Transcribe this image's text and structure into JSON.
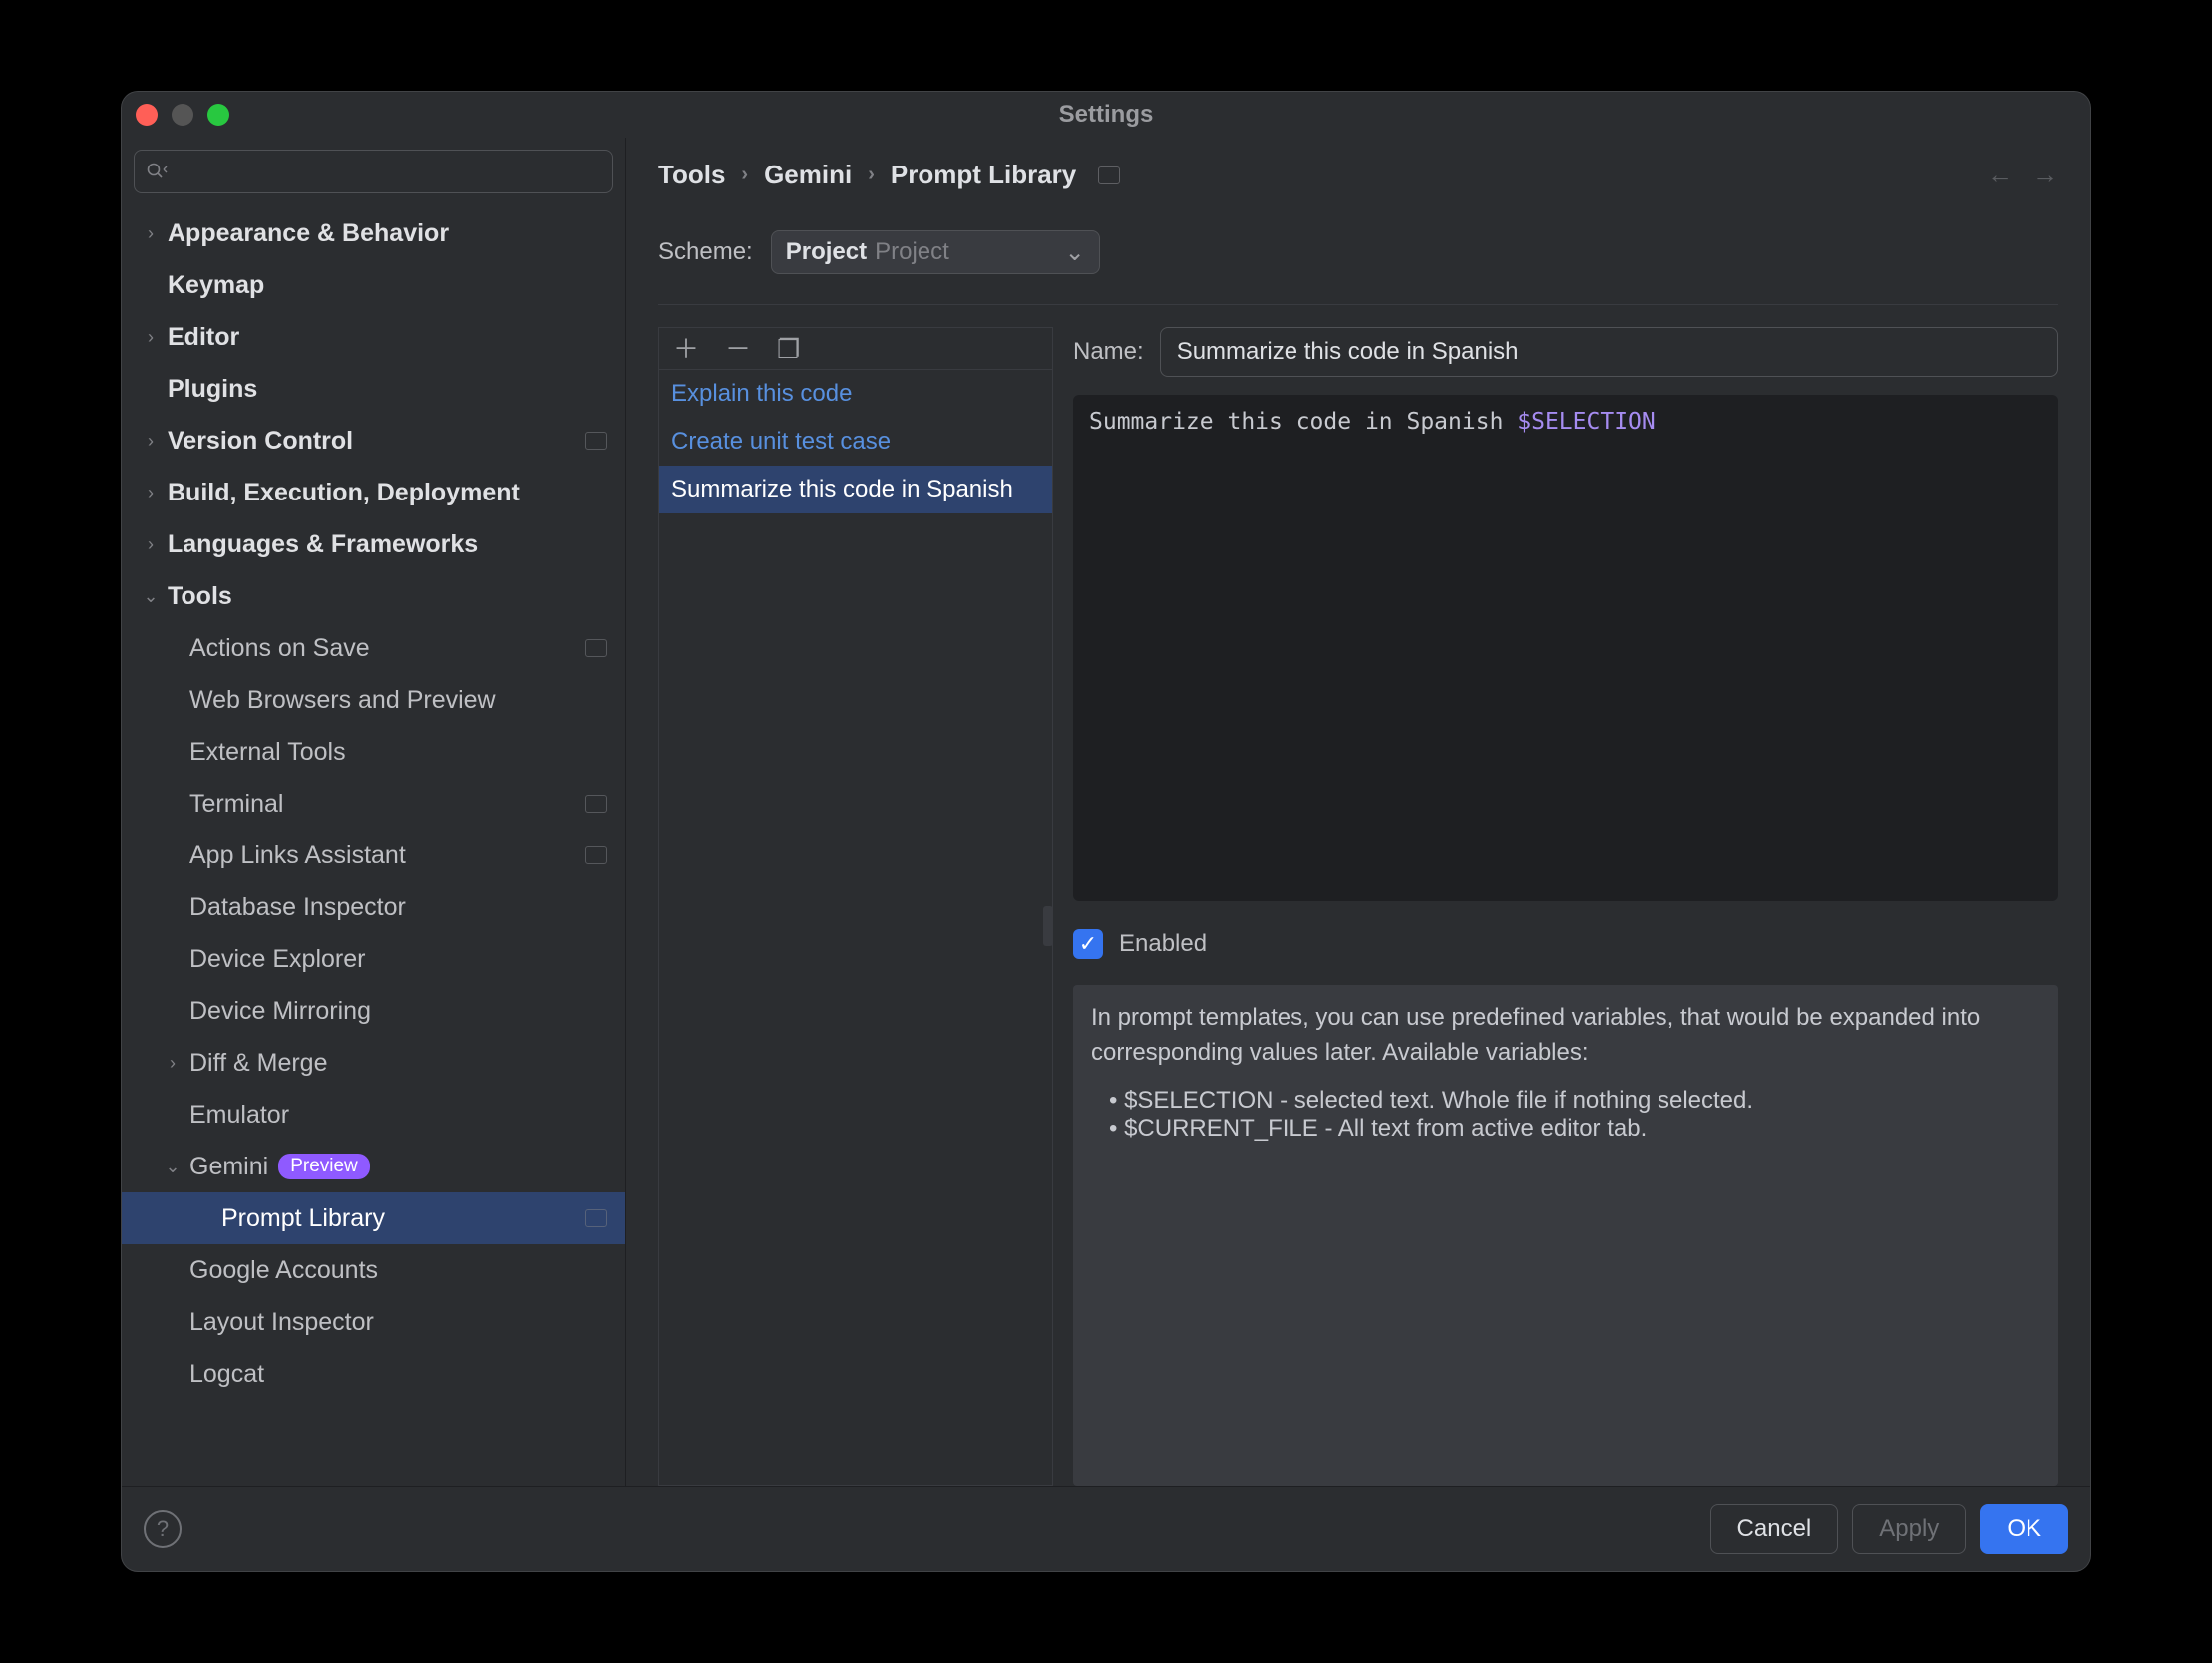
{
  "window": {
    "title": "Settings"
  },
  "sidebar": {
    "search_placeholder": "",
    "items": [
      {
        "label": "Appearance & Behavior",
        "level": 1,
        "chev": "right",
        "bold": true
      },
      {
        "label": "Keymap",
        "level": 1,
        "bold": true
      },
      {
        "label": "Editor",
        "level": 1,
        "chev": "right",
        "bold": true
      },
      {
        "label": "Plugins",
        "level": 1,
        "bold": true
      },
      {
        "label": "Version Control",
        "level": 1,
        "chev": "right",
        "bold": true,
        "proj": true
      },
      {
        "label": "Build, Execution, Deployment",
        "level": 1,
        "chev": "right",
        "bold": true
      },
      {
        "label": "Languages & Frameworks",
        "level": 1,
        "chev": "right",
        "bold": true
      },
      {
        "label": "Tools",
        "level": 1,
        "chev": "down",
        "bold": true
      },
      {
        "label": "Actions on Save",
        "level": 2,
        "proj": true
      },
      {
        "label": "Web Browsers and Preview",
        "level": 2
      },
      {
        "label": "External Tools",
        "level": 2
      },
      {
        "label": "Terminal",
        "level": 2,
        "proj": true
      },
      {
        "label": "App Links Assistant",
        "level": 2,
        "proj": true
      },
      {
        "label": "Database Inspector",
        "level": 2
      },
      {
        "label": "Device Explorer",
        "level": 2
      },
      {
        "label": "Device Mirroring",
        "level": 2
      },
      {
        "label": "Diff & Merge",
        "level": 2,
        "chev": "right"
      },
      {
        "label": "Emulator",
        "level": 2
      },
      {
        "label": "Gemini",
        "level": 2,
        "chev": "down",
        "badge": "Preview"
      },
      {
        "label": "Prompt Library",
        "level": 3,
        "selected": true,
        "proj": true
      },
      {
        "label": "Google Accounts",
        "level": 2
      },
      {
        "label": "Layout Inspector",
        "level": 2
      },
      {
        "label": "Logcat",
        "level": 2
      }
    ]
  },
  "breadcrumbs": [
    "Tools",
    "Gemini",
    "Prompt Library"
  ],
  "scheme": {
    "label": "Scheme:",
    "primary": "Project",
    "secondary": "Project"
  },
  "prompts": {
    "items": [
      {
        "label": "Explain this code",
        "link": true
      },
      {
        "label": "Create unit test case",
        "link": true
      },
      {
        "label": "Summarize this code in Spanish",
        "selected": true
      }
    ]
  },
  "detail": {
    "name_label": "Name:",
    "name_value": "Summarize this code in Spanish",
    "body_text": "Summarize this code in Spanish ",
    "body_var": "$SELECTION",
    "enabled_label": "Enabled",
    "enabled_checked": true,
    "help_intro": "In prompt templates, you can use predefined variables, that would be expanded into corresponding values later. Available variables:",
    "help_b1": "• $SELECTION - selected text. Whole file if nothing selected.",
    "help_b2": "• $CURRENT_FILE - All text from active editor tab."
  },
  "footer": {
    "cancel": "Cancel",
    "apply": "Apply",
    "ok": "OK"
  }
}
